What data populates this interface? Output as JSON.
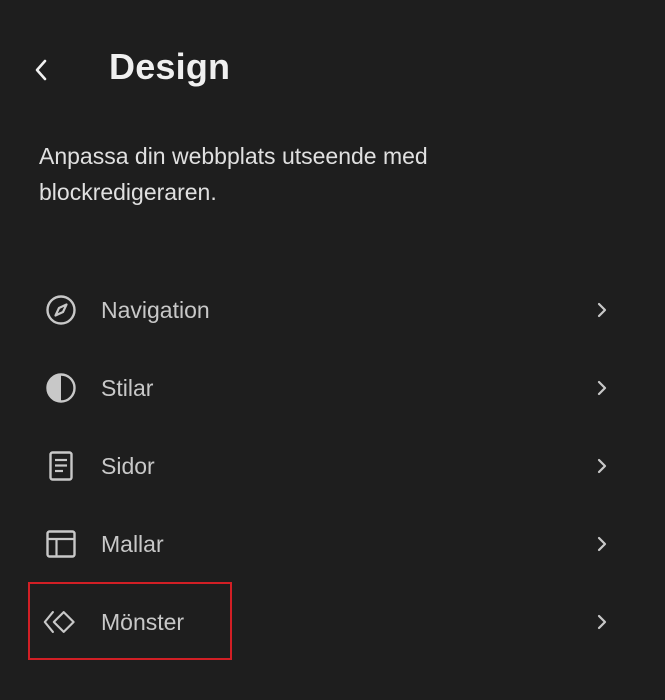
{
  "header": {
    "back_icon": "chevron-left-icon",
    "title": "Design"
  },
  "description": "Anpassa din webbplats utseende med blockredigeraren.",
  "menu": {
    "items": [
      {
        "label": "Navigation",
        "icon": "navigation-compass-icon"
      },
      {
        "label": "Stilar",
        "icon": "styles-half-circle-icon"
      },
      {
        "label": "Sidor",
        "icon": "pages-document-icon"
      },
      {
        "label": "Mallar",
        "icon": "templates-layout-icon"
      },
      {
        "label": "Mönster",
        "icon": "patterns-diamond-icon",
        "highlighted": true
      }
    ],
    "chevron_icon": "chevron-right-icon"
  },
  "colors": {
    "background": "#1e1e1e",
    "text": "#e0e0e0",
    "muted_text": "#c8c8c8",
    "highlight_border": "#d21f25"
  }
}
